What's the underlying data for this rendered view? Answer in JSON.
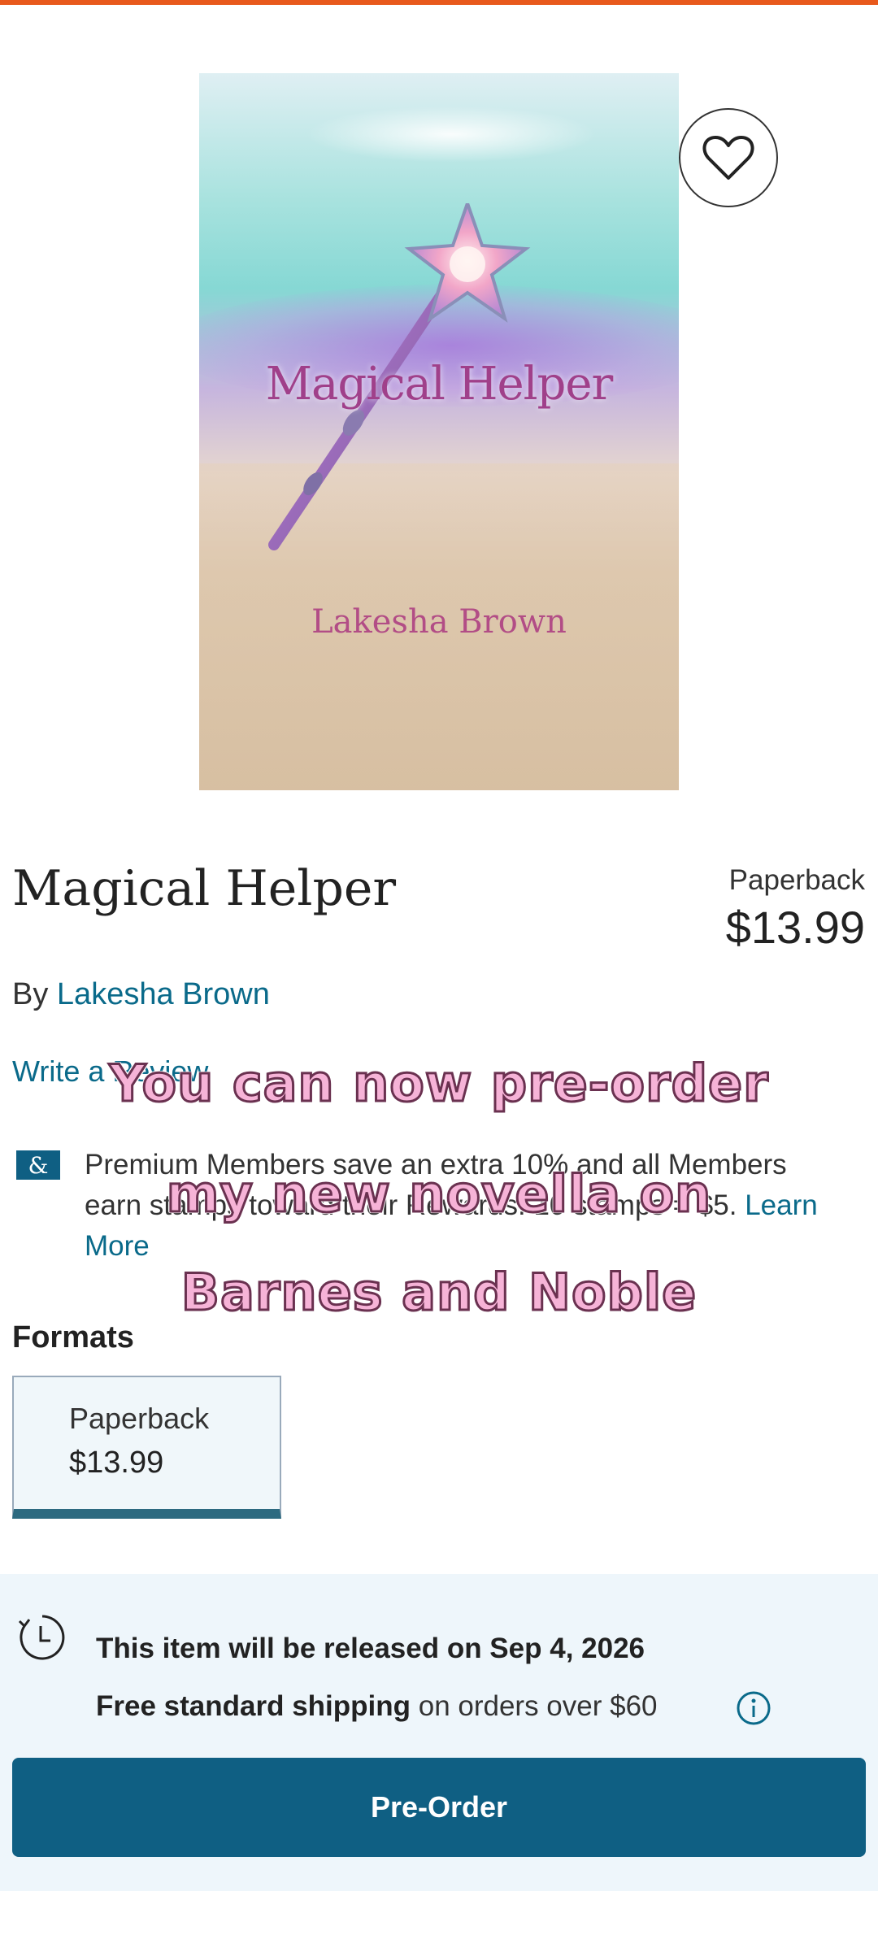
{
  "product": {
    "title": "Magical Helper",
    "author_prefix": "By",
    "author": "Lakesha Brown",
    "format": "Paperback",
    "price": "$13.99",
    "cover": {
      "title": "Magical Helper",
      "author": "Lakesha Brown"
    },
    "favorite_icon": "heart-icon"
  },
  "reviews": {
    "write_label": "Write a Review"
  },
  "membership": {
    "badge": "&",
    "text": "Premium Members save an extra 10% and all Members earn stamps toward their Rewards. 10 stamps = $5.",
    "learn_more": "Learn More"
  },
  "formats": {
    "heading": "Formats",
    "items": [
      {
        "name": "Paperback",
        "price": "$13.99"
      }
    ]
  },
  "release": {
    "icon": "clock-icon",
    "text": "This item will be released on Sep 4, 2026",
    "shipping_bold": "Free standard shipping",
    "shipping_rest": " on orders over $60",
    "info_icon": "info-icon"
  },
  "cta": {
    "preorder_label": "Pre-Order"
  },
  "overlay": {
    "line1": "You can now pre-order",
    "line2": "my new novella on",
    "line3": "Barnes and Noble"
  },
  "colors": {
    "accent": "#0f5f83",
    "link": "#0a6a8a",
    "topbar": "#e8591c",
    "overlay_pink": "#f6b3d7"
  }
}
